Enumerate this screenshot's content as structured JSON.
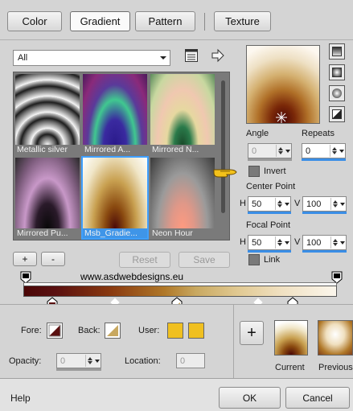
{
  "tabs": [
    {
      "label": "Color",
      "active": false
    },
    {
      "label": "Gradient",
      "active": true
    },
    {
      "label": "Pattern",
      "active": false
    },
    {
      "label": "Texture",
      "active": false
    }
  ],
  "category_select": {
    "value": "All"
  },
  "presets": [
    {
      "label": "Metallic silver",
      "selected": false
    },
    {
      "label": "Mirrored A...",
      "selected": false
    },
    {
      "label": "Mirrored N...",
      "selected": false
    },
    {
      "label": "Mirrored Pu...",
      "selected": false
    },
    {
      "label": "Msb_Gradie...",
      "selected": true
    },
    {
      "label": "Neon Hour",
      "selected": false
    }
  ],
  "preset_buttons": {
    "add": "+",
    "remove": "-",
    "reset": "Reset",
    "save": "Save"
  },
  "watermark": "www.asdwebdesigns.eu",
  "angle": {
    "label": "Angle",
    "value": "0"
  },
  "repeats": {
    "label": "Repeats",
    "value": "0"
  },
  "invert": {
    "label": "Invert",
    "checked": false
  },
  "center_point": {
    "label": "Center Point",
    "h_label": "H",
    "h_value": "50",
    "v_label": "V",
    "v_value": "100"
  },
  "focal_point": {
    "label": "Focal Point",
    "h_label": "H",
    "h_value": "50",
    "v_label": "V",
    "v_value": "100"
  },
  "link": {
    "label": "Link",
    "checked": false
  },
  "stops": {
    "fore_label": "Fore:",
    "back_label": "Back:",
    "user_label": "User:",
    "opacity_label": "Opacity:",
    "opacity_value": "0",
    "location_label": "Location:",
    "location_value": "0"
  },
  "history": {
    "add": "+",
    "current_label": "Current",
    "previous_label": "Previous"
  },
  "footer": {
    "help": "Help",
    "ok": "OK",
    "cancel": "Cancel"
  },
  "colors": {
    "accent": "#3a8ee6",
    "fore": "#5a1010",
    "back": "#c8a860",
    "user1": "#f0c020",
    "user2": "#f0c020"
  }
}
